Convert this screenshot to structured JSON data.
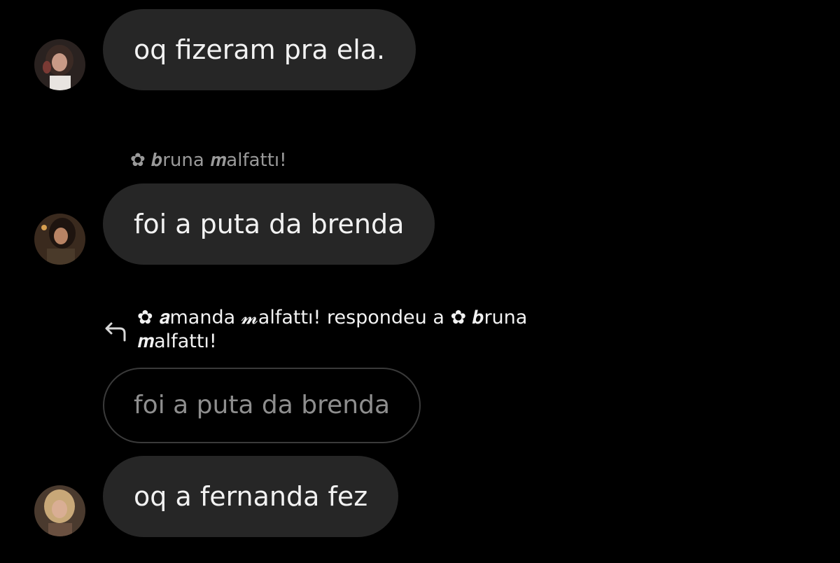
{
  "messages": [
    {
      "text": "oq fizeram pra ela."
    },
    {
      "sender": "✿ 𝒃runa 𝒎alfattı!",
      "text": "foi a puta da brenda"
    },
    {
      "reply": {
        "label": "✿ 𝒂manda 𝓶alfattı! respondeu a ✿ 𝒃runa 𝒎alfattı!",
        "quoted_text": "foi a puta da brenda"
      },
      "text": "oq a fernanda fez"
    }
  ],
  "colors": {
    "background": "#000000",
    "bubble": "#262626",
    "bubble_text": "#f2f2f2",
    "quoted_border": "#3a3a3a",
    "quoted_text": "#8e8e8e",
    "sender_text": "#9a9a9a"
  }
}
